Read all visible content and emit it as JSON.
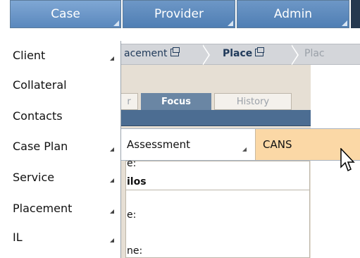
{
  "top_nav": {
    "case_label": "Case",
    "provider_label": "Provider",
    "admin_label": "Admin"
  },
  "case_menu": {
    "items": [
      {
        "label": "Client",
        "has_submenu": true
      },
      {
        "label": "Collateral",
        "has_submenu": false
      },
      {
        "label": "Contacts",
        "has_submenu": false
      },
      {
        "label": "Case Plan",
        "has_submenu": true
      },
      {
        "label": "Service",
        "has_submenu": true
      },
      {
        "label": "Placement",
        "has_submenu": true
      },
      {
        "label": "IL",
        "has_submenu": true
      }
    ]
  },
  "breadcrumb": {
    "item1": "acement",
    "item2": "Place",
    "item3": "Plac"
  },
  "tabs": {
    "left_partial": "r",
    "focus": "Focus",
    "history": "History"
  },
  "submenu": {
    "assessment_label": "Assessment",
    "cans_label": "CANS"
  },
  "content_fragments": {
    "line1": "e:",
    "line2": "ilos",
    "line3": "e:",
    "line4": "ne:"
  },
  "colors": {
    "nav_blue": "#5a88bd",
    "highlight": "#fbd8a6",
    "tab_active": "#6a86a4"
  }
}
